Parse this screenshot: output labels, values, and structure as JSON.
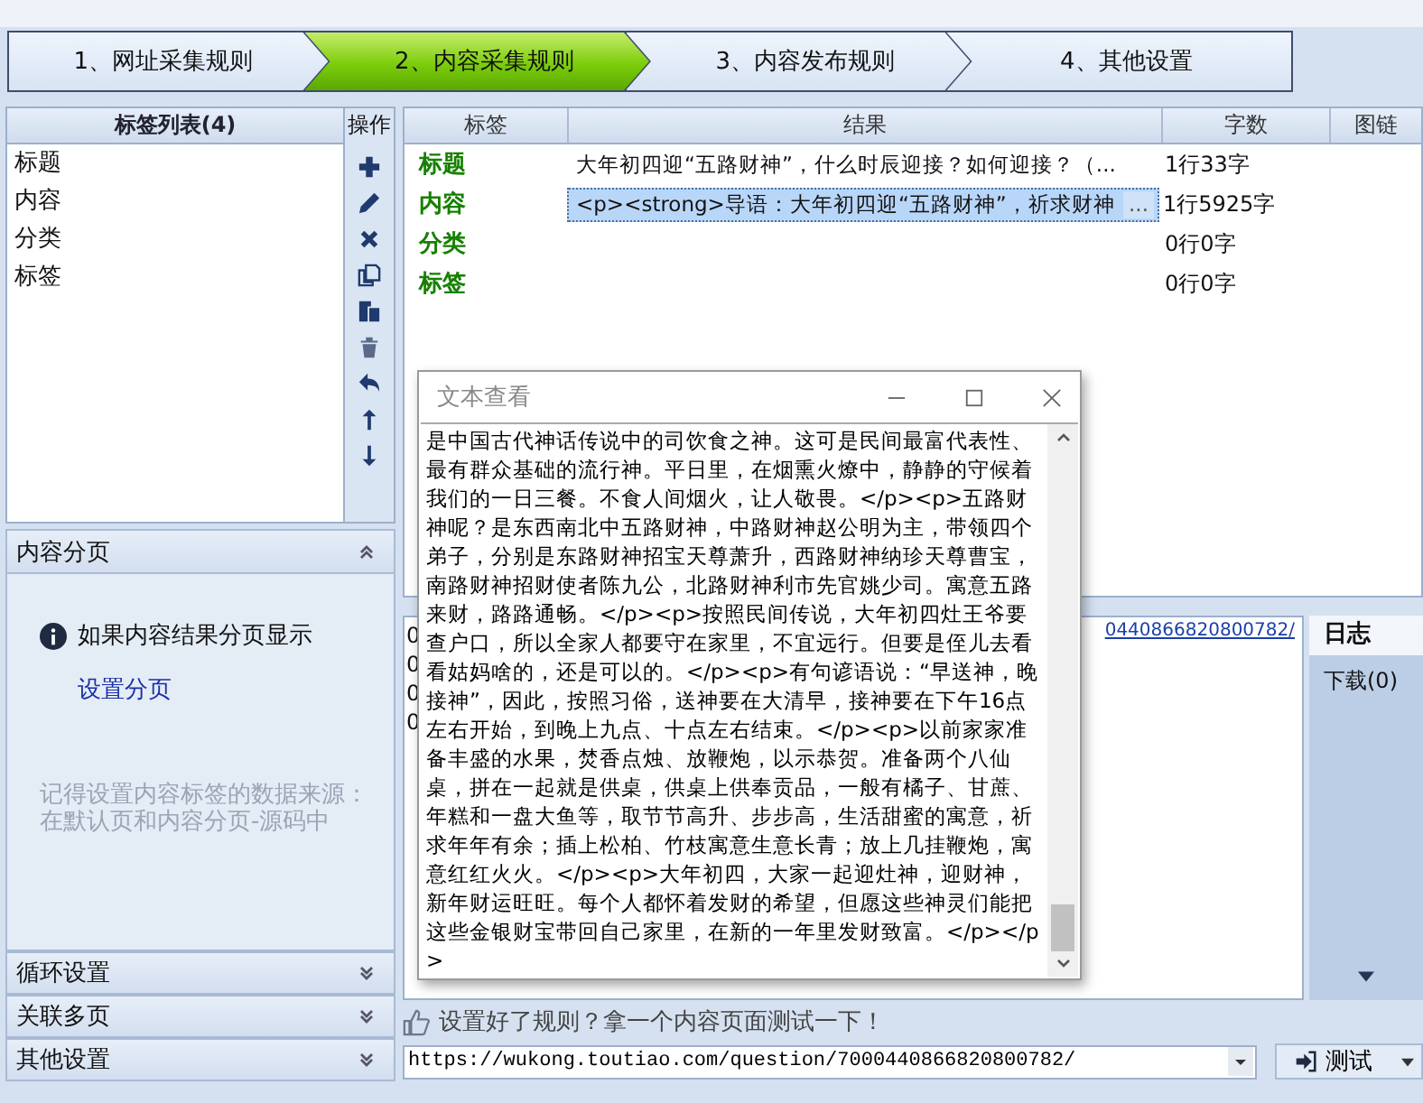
{
  "steps": [
    {
      "label": "1、网址采集规则",
      "selected": false
    },
    {
      "label": "2、内容采集规则",
      "selected": true
    },
    {
      "label": "3、内容发布规则",
      "selected": false
    },
    {
      "label": "4、其他设置",
      "selected": false
    }
  ],
  "tag_list": {
    "title": "标签列表(4)",
    "items": [
      "标题",
      "内容",
      "分类",
      "标签"
    ]
  },
  "operations": {
    "title": "操作"
  },
  "results_table": {
    "columns": [
      "标签",
      "结果",
      "字数",
      "图链"
    ],
    "rows": [
      {
        "tag": "标题",
        "result": "大年初四迎“五路财神”，什么时辰迎接？如何迎接？（...",
        "count": "1行33字",
        "selected": false
      },
      {
        "tag": "内容",
        "result": "<p><strong>导语：大年初四迎“五路财神”，祈求财神",
        "more": "...",
        "count": "1行5925字",
        "selected": true
      },
      {
        "tag": "分类",
        "count": "0行0字",
        "selected": false
      },
      {
        "tag": "标签",
        "count": "0行0字",
        "selected": false
      }
    ]
  },
  "paging_section": {
    "title": "内容分页",
    "expanded": true,
    "info": "如果内容结果分页显示",
    "link": "设置分页",
    "note": "记得设置内容标签的数据来源：在默认页和内容分页-源码中"
  },
  "collapsed_sections": [
    {
      "title": "循环设置",
      "expanded": false
    },
    {
      "title": "关联多页",
      "expanded": false
    },
    {
      "title": "其他设置",
      "expanded": false
    }
  ],
  "output_panel": {
    "lines": [
      "0",
      "0",
      "0",
      "0"
    ],
    "link": "0440866820800782/"
  },
  "log_panel": {
    "title": "日志",
    "items": [
      "下载(0)"
    ]
  },
  "tip": "设置好了规则？拿一个内容页面测试一下！",
  "url_field": {
    "value": "https://wukong.toutiao.com/question/7000440866820800782/"
  },
  "test_button": {
    "label": "测试"
  },
  "text_viewer": {
    "title": "文本查看",
    "content": "是中国古代神话传说中的司饮食之神。这可是民间最富代表性、最有群众基础的流行神。平日里，在烟熏火燎中，静静的守候着我们的一日三餐。不食人间烟火，让人敬畏。</p><p>五路财神呢？是东西南北中五路财神，中路财神赵公明为主，带领四个弟子，分别是东路财神招宝天尊萧升，西路财神纳珍天尊曹宝，南路财神招财使者陈九公，北路财神利市先官姚少司。寓意五路来财，路路通畅。</p><p>按照民间传说，大年初四灶王爷要查户口，所以全家人都要守在家里，不宜远行。但要是侄儿去看看姑妈啥的，还是可以的。</p><p>有句谚语说：“早送神，晚接神”，因此，按照习俗，送神要在大清早，接神要在下午16点左右开始，到晚上九点、十点左右结束。</p><p>以前家家准备丰盛的水果，焚香点烛、放鞭炮，以示恭贺。准备两个八仙桌，拼在一起就是供桌，供桌上供奉贡品，一般有橘子、甘蔗、年糕和一盘大鱼等，取节节高升、步步高，生活甜蜜的寓意，祈求年年有余；插上松柏、竹枝寓意生意长青；放上几挂鞭炮，寓意红红火火。</p><p>大年初四，大家一起迎灶神，迎财神，新年财运旺旺。每个人都怀着发财的希望，但愿这些神灵们能把这些金银财宝带回自己家里，在新的一年里发财致富。</p></p>"
  }
}
